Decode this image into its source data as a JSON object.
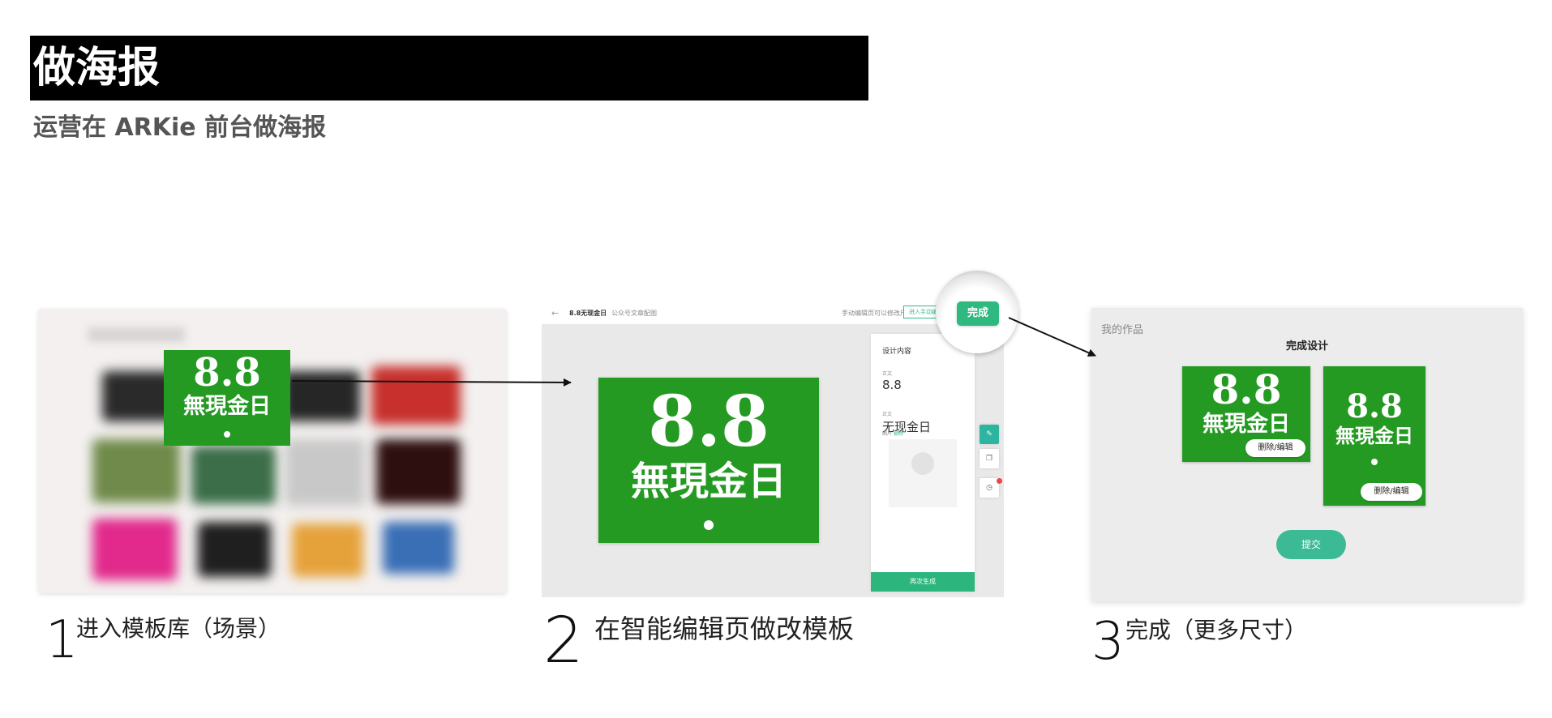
{
  "header": {
    "title": "做海报",
    "subtitle": "运营在 ARKie 前台做海报"
  },
  "poster": {
    "number": "8.8",
    "tagline": "無現金日"
  },
  "step1": {
    "number": "1",
    "label": "进入模板库（场景）",
    "blurred_tile_colors": [
      "#2a2a2a",
      "#3d3d3d",
      "#262626",
      "#c7302c",
      "#6f8a4a",
      "#3b6e49",
      "#c8c8c8",
      "#2e0f10",
      "#e22a8c",
      "#1f1f1f",
      "#e6a23a",
      "#3a6fb6"
    ]
  },
  "step2": {
    "number": "2",
    "label": "在智能编辑页做改模板",
    "editor": {
      "back_arrow": "←",
      "name": "8.8无现金日",
      "size": "公众号文章配图",
      "hint": "手动编辑页可以修改尺寸",
      "manual_button": "进入手动编",
      "done_button": "完成",
      "panel_title": "设计内容",
      "field1_label": "正文",
      "field1_value": "8.8",
      "field2_label": "正文",
      "field2_value": "无现金日",
      "image_label": "图片",
      "image_action": "删除",
      "regen_button": "再次生成"
    }
  },
  "step3": {
    "number": "3",
    "label": "完成（更多尺寸）",
    "works_label": "我的作品",
    "complete_title": "完成设计",
    "edit_label": "删除/编辑",
    "submit_button": "提交"
  },
  "colors": {
    "poster_green": "#249a22",
    "accent_green": "#2db97f",
    "title_bar": "#000000"
  },
  "icons": [
    "arrow-right-icon",
    "pencil-icon",
    "layers-icon",
    "history-icon",
    "wechat-logo-icon",
    "back-arrow-icon"
  ]
}
